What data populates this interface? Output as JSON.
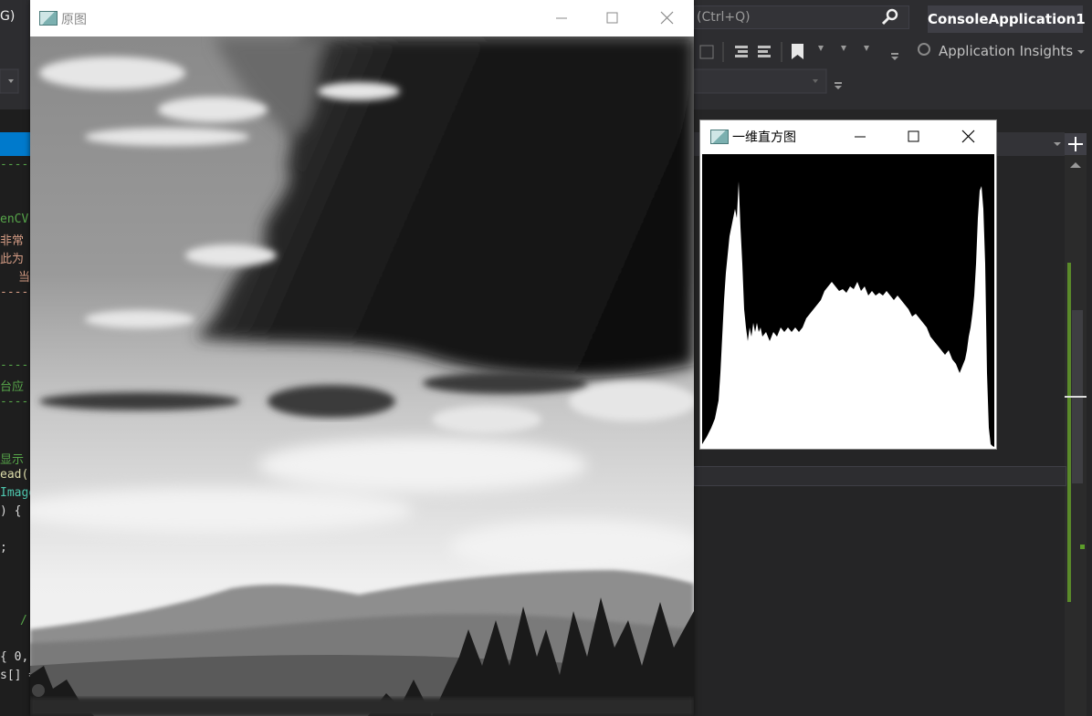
{
  "vs": {
    "menu_fragment": "G)",
    "search_text": "(Ctrl+Q)",
    "solution_name": "ConsoleApplication1",
    "app_insights": "Application Insights",
    "code_fragments": [
      "---------",
      "enCV",
      "非常",
      "此为",
      "当",
      "----",
      "------",
      "台应",
      "------",
      "显示",
      "ead(",
      "Image",
      ") { ",
      ";",
      "/",
      "{ 0,",
      "s[] ="
    ]
  },
  "windows": {
    "original": {
      "title": "原图"
    },
    "histogram": {
      "title": "一维直方图"
    }
  },
  "colors": {
    "vs_bg": "#1e1e1e",
    "vs_chrome": "#2d2d30",
    "accent": "#007acc"
  }
}
